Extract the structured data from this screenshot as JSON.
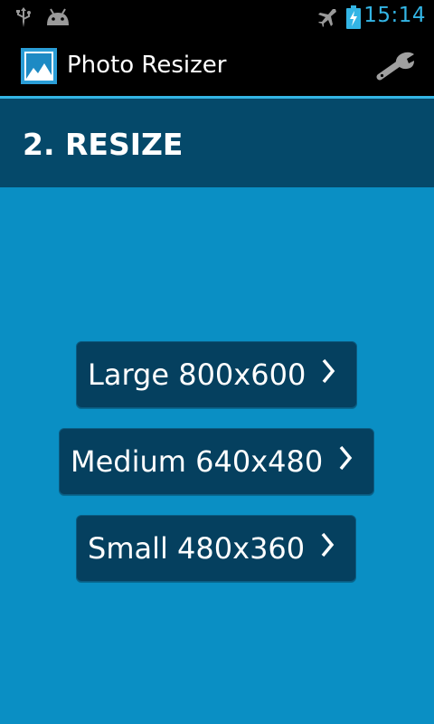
{
  "status_bar": {
    "time": "15:14",
    "icons": [
      "usb-icon",
      "android-icon",
      "airplane-mode-icon",
      "battery-charging-icon"
    ],
    "time_color": "#33b5e5"
  },
  "action_bar": {
    "app_title": "Photo Resizer",
    "app_icon": "photo-app-icon",
    "settings_icon": "wrench-icon",
    "accent_color": "#33b5e5"
  },
  "section": {
    "title": "2. RESIZE",
    "band_color": "#05496a"
  },
  "content": {
    "background_color": "#0a8fc4",
    "buttons": [
      {
        "label": "Large 800x600",
        "icon": "chevron-right-icon"
      },
      {
        "label": "Medium 640x480",
        "icon": "chevron-right-icon"
      },
      {
        "label": "Small 480x360",
        "icon": "chevron-right-icon"
      }
    ],
    "button_color": "#05405f"
  }
}
